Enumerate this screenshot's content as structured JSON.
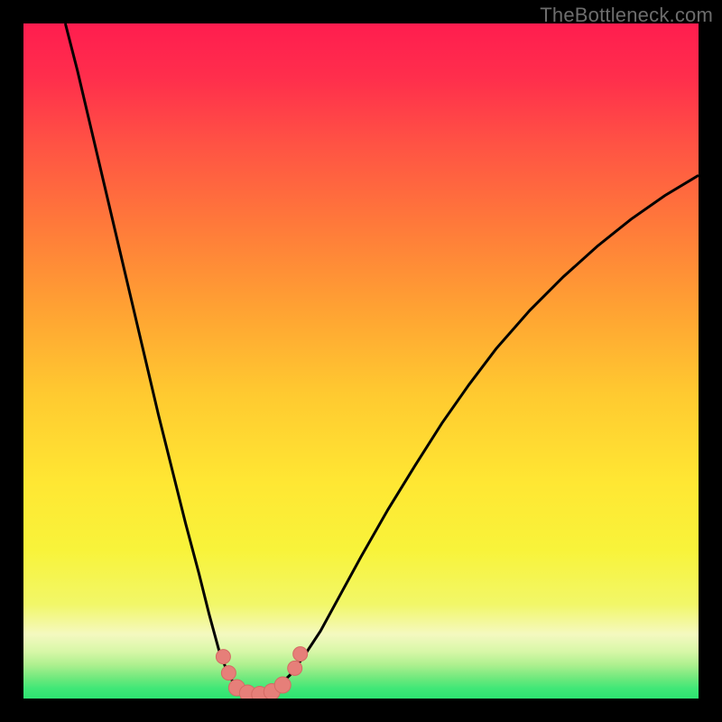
{
  "watermark": "TheBottleneck.com",
  "colors": {
    "gradient_stops": [
      {
        "offset": 0.0,
        "color": "#ff1d4f"
      },
      {
        "offset": 0.08,
        "color": "#ff2e4c"
      },
      {
        "offset": 0.18,
        "color": "#ff5344"
      },
      {
        "offset": 0.3,
        "color": "#ff7a3a"
      },
      {
        "offset": 0.42,
        "color": "#ffa133"
      },
      {
        "offset": 0.55,
        "color": "#ffca30"
      },
      {
        "offset": 0.68,
        "color": "#ffe733"
      },
      {
        "offset": 0.78,
        "color": "#f8f33a"
      },
      {
        "offset": 0.86,
        "color": "#f2f768"
      },
      {
        "offset": 0.905,
        "color": "#f4f9c0"
      },
      {
        "offset": 0.93,
        "color": "#d8f7a8"
      },
      {
        "offset": 0.95,
        "color": "#aef08f"
      },
      {
        "offset": 0.97,
        "color": "#6fe97d"
      },
      {
        "offset": 0.985,
        "color": "#40e777"
      },
      {
        "offset": 1.0,
        "color": "#2de371"
      }
    ],
    "curve_stroke": "#000000",
    "marker_fill": "#e67f79",
    "marker_stroke": "#d46a64"
  },
  "chart_data": {
    "type": "line",
    "title": "",
    "xlabel": "",
    "ylabel": "",
    "x_range": [
      0,
      100
    ],
    "y_range": [
      0,
      100
    ],
    "curve_points": [
      {
        "x": 6.2,
        "y": 100
      },
      {
        "x": 8,
        "y": 93
      },
      {
        "x": 10,
        "y": 84.5
      },
      {
        "x": 12,
        "y": 76
      },
      {
        "x": 14,
        "y": 67.5
      },
      {
        "x": 16,
        "y": 59
      },
      {
        "x": 18,
        "y": 50.5
      },
      {
        "x": 20,
        "y": 42
      },
      {
        "x": 22,
        "y": 34
      },
      {
        "x": 24,
        "y": 26
      },
      {
        "x": 26,
        "y": 18.5
      },
      {
        "x": 27.5,
        "y": 12.5
      },
      {
        "x": 29,
        "y": 7
      },
      {
        "x": 30.5,
        "y": 3.2
      },
      {
        "x": 32,
        "y": 1.3
      },
      {
        "x": 33.5,
        "y": 0.6
      },
      {
        "x": 35.5,
        "y": 0.6
      },
      {
        "x": 37.5,
        "y": 1.6
      },
      {
        "x": 39.5,
        "y": 3.5
      },
      {
        "x": 41.5,
        "y": 6.2
      },
      {
        "x": 44,
        "y": 10
      },
      {
        "x": 47,
        "y": 15.5
      },
      {
        "x": 50,
        "y": 21
      },
      {
        "x": 54,
        "y": 28
      },
      {
        "x": 58,
        "y": 34.5
      },
      {
        "x": 62,
        "y": 40.8
      },
      {
        "x": 66,
        "y": 46.5
      },
      {
        "x": 70,
        "y": 51.8
      },
      {
        "x": 75,
        "y": 57.5
      },
      {
        "x": 80,
        "y": 62.5
      },
      {
        "x": 85,
        "y": 67
      },
      {
        "x": 90,
        "y": 71
      },
      {
        "x": 95,
        "y": 74.5
      },
      {
        "x": 100,
        "y": 77.5
      }
    ],
    "markers": [
      {
        "x": 29.6,
        "y": 6.2,
        "r": 8
      },
      {
        "x": 30.4,
        "y": 3.8,
        "r": 8
      },
      {
        "x": 31.6,
        "y": 1.6,
        "r": 9
      },
      {
        "x": 33.2,
        "y": 0.8,
        "r": 9
      },
      {
        "x": 35.0,
        "y": 0.6,
        "r": 9
      },
      {
        "x": 36.8,
        "y": 1.0,
        "r": 9
      },
      {
        "x": 38.4,
        "y": 2.0,
        "r": 9
      },
      {
        "x": 40.2,
        "y": 4.5,
        "r": 8
      },
      {
        "x": 41.0,
        "y": 6.6,
        "r": 8
      }
    ]
  }
}
